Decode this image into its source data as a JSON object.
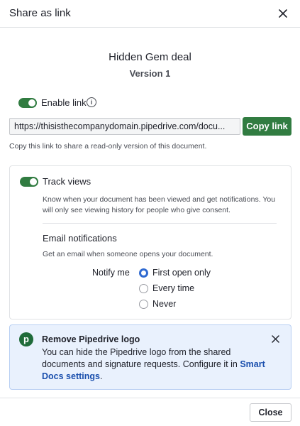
{
  "dialog": {
    "title": "Share as link",
    "close_icon": "close-icon"
  },
  "document": {
    "title": "Hidden Gem deal",
    "version": "Version 1"
  },
  "enable_link": {
    "label": "Enable link",
    "enabled": true,
    "info_icon": "i"
  },
  "share_link": {
    "value": "https://thisisthecompanydomain.pipedrive.com/docu...",
    "copy_label": "Copy link",
    "helper": "Copy this link to share a read-only version of this document."
  },
  "track_views": {
    "label": "Track views",
    "enabled": true,
    "description": "Know when your document has been viewed and get notifications. You will only see viewing history for people who give consent.",
    "email_title": "Email notifications",
    "email_description": "Get an email when someone opens your document.",
    "notify_label": "Notify me",
    "options": [
      "First open only",
      "Every time",
      "Never"
    ],
    "selected": "First open only"
  },
  "banner": {
    "logo_letter": "p",
    "title": "Remove Pipedrive logo",
    "text": "You can hide the Pipedrive logo from the shared documents and signature requests. Configure it in ",
    "link_text": "Smart Docs settings",
    "text_end": "."
  },
  "footer": {
    "close_label": "Close"
  },
  "colors": {
    "primary_green": "#317c41",
    "radio_blue": "#2f6ad1",
    "banner_bg": "#e9f1fd",
    "link_blue": "#1a4fad"
  }
}
